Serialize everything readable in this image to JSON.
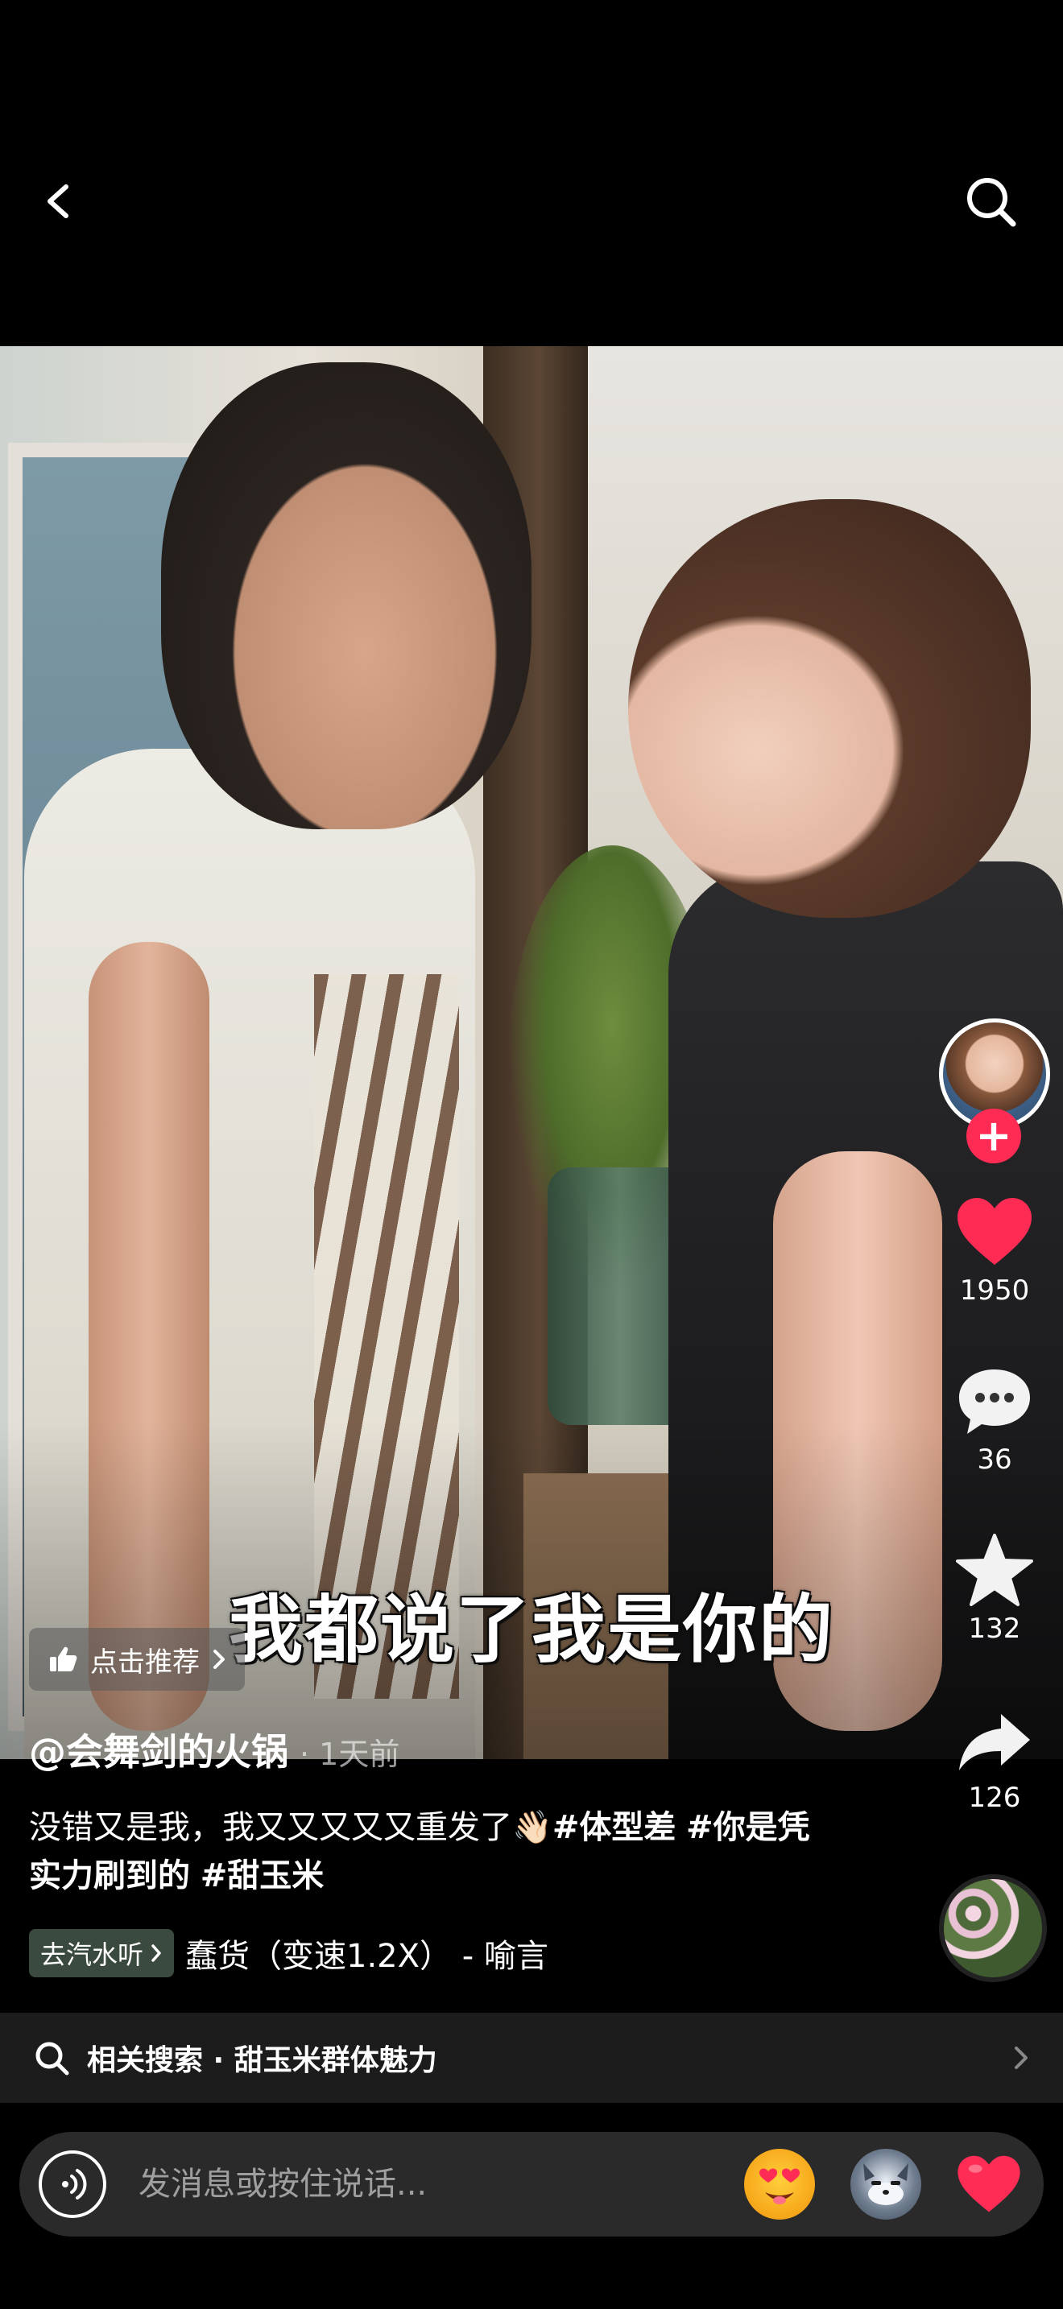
{
  "nav": {
    "back_icon": "chevron-left-icon",
    "search_icon": "search-icon"
  },
  "video": {
    "subtitle": "我都说了我是你的"
  },
  "recommend": {
    "label": "点击推荐"
  },
  "post": {
    "author": "@会舞剑的火锅",
    "time": "· 1天前",
    "caption_text": "没错又是我，我又又又又又重发了👋🏻",
    "tags": [
      "#体型差",
      "#你是凭实力刷到的",
      "#甜玉米"
    ],
    "music_badge": "去汽水听",
    "music_title": "蠢货（变速1.2X） - 喻言"
  },
  "actions": {
    "like_count": "1950",
    "comment_count": "36",
    "favorite_count": "132",
    "share_count": "126",
    "follow_label": "+"
  },
  "related": {
    "label": "相关搜索 · 甜玉米群体魅力"
  },
  "message": {
    "placeholder": "发消息或按住说话..."
  },
  "colors": {
    "accent": "#fe2c55",
    "background": "#000000",
    "bar": "#2a2a2a"
  }
}
